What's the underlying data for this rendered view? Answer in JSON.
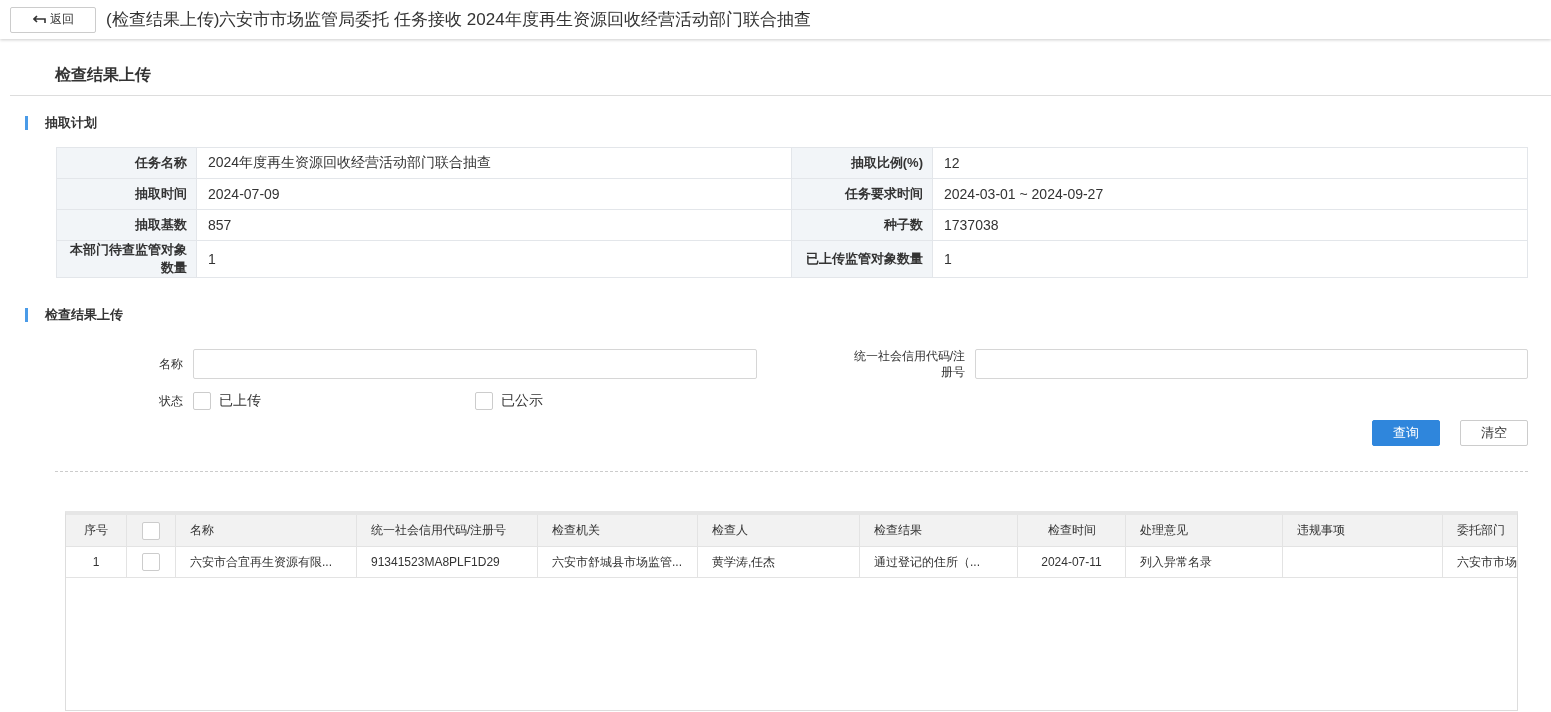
{
  "header": {
    "back_button": "返回",
    "title": "(检查结果上传)六安市市场监管局委托 任务接收 2024年度再生资源回收经营活动部门联合抽查"
  },
  "page_title": "检查结果上传",
  "plan": {
    "heading": "抽取计划",
    "fields": [
      {
        "label": "任务名称",
        "value": "2024年度再生资源回收经营活动部门联合抽查"
      },
      {
        "label": "抽取比例(%)",
        "value": "12"
      },
      {
        "label": "抽取时间",
        "value": "2024-07-09"
      },
      {
        "label": "任务要求时间",
        "value": "2024-03-01 ~ 2024-09-27"
      },
      {
        "label": "抽取基数",
        "value": "857"
      },
      {
        "label": "种子数",
        "value": "1737038"
      },
      {
        "label": "本部门待查监管对象数量",
        "value": "1"
      },
      {
        "label": "已上传监管对象数量",
        "value": "1"
      }
    ]
  },
  "search": {
    "heading": "检查结果上传",
    "fields": [
      {
        "label": "名称"
      },
      {
        "label": "统一社会信用代码/注册号"
      }
    ],
    "status": {
      "label": "状态",
      "options": [
        {
          "label": "已上传",
          "checked": false
        },
        {
          "label": "已公示",
          "checked": false
        }
      ]
    },
    "buttons": [
      {
        "label": "查询",
        "kind": "primary"
      },
      {
        "label": "清空",
        "kind": "default"
      }
    ]
  },
  "table": {
    "select_all_checked": false,
    "columns": [
      "序号",
      "名称",
      "统一社会信用代码/注册号",
      "检查机关",
      "检查人",
      "检查结果",
      "检查时间",
      "处理意见",
      "违规事项",
      "委托部门"
    ],
    "rows": [
      {
        "checked": false,
        "cells": [
          "1",
          "六安市合宜再生资源有限...",
          "91341523MA8PLF1D29",
          "六安市舒城县市场监管...",
          "黄学涛,任杰",
          "通过登记的住所（...",
          "2024-07-11",
          "列入异常名录",
          "",
          "六安市市场"
        ]
      }
    ]
  }
}
